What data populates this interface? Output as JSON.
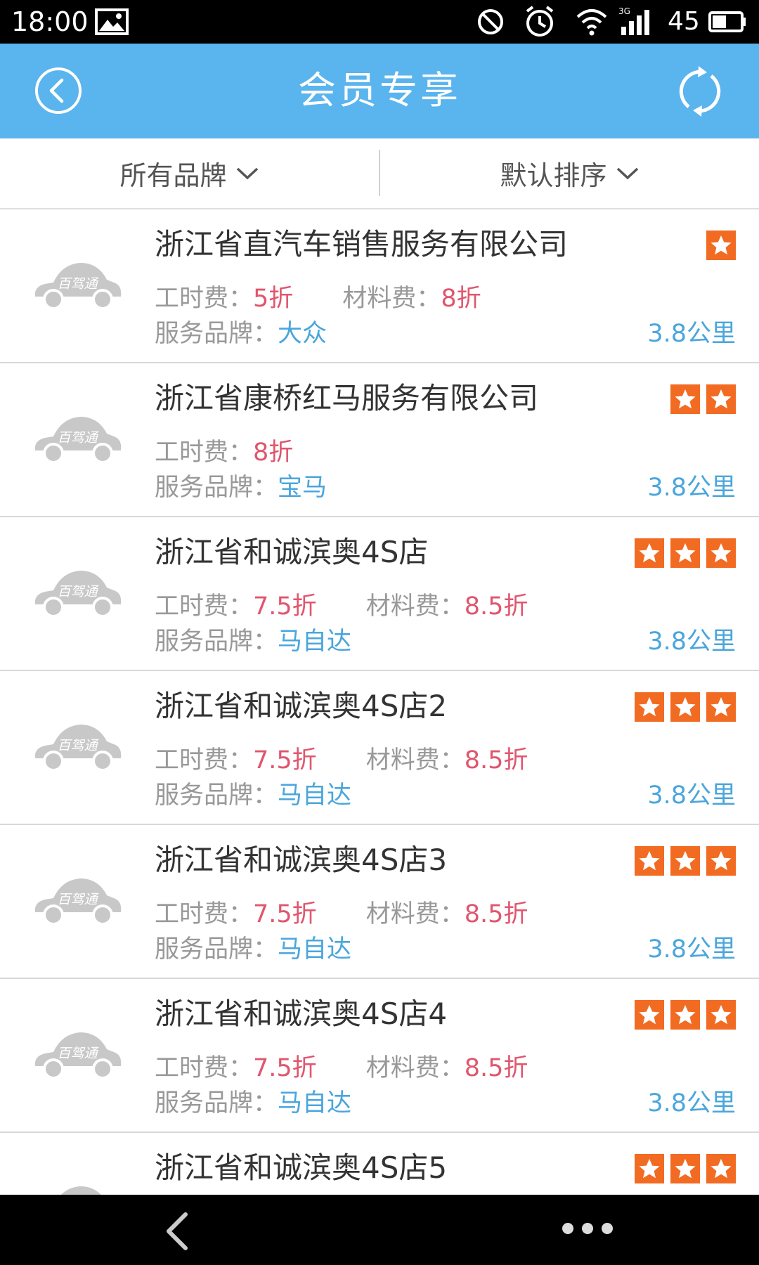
{
  "status_bar": {
    "time": "18:00",
    "battery": "45",
    "network": "3G",
    "icons": [
      "image-icon",
      "do-not-disturb-icon",
      "alarm-icon",
      "wifi-icon",
      "signal-icon",
      "battery-icon"
    ]
  },
  "header": {
    "title": "会员专享",
    "back_icon": "back-circle-icon",
    "refresh_icon": "refresh-icon",
    "background_color": "#5ab4ee"
  },
  "filters": {
    "brand": "所有品牌",
    "sort": "默认排序"
  },
  "colors": {
    "discount": "#e0566e",
    "brand_link": "#4aa6dc",
    "star_badge": "#f26b22"
  },
  "stores": [
    {
      "name": "浙江省直汽车销售服务有限公司",
      "labor_label": "工时费：",
      "labor": "5折",
      "material_label": "材料费：",
      "material": "8折",
      "brand_label": "服务品牌：",
      "brand": "大众",
      "distance": "3.8公里",
      "stars": 1,
      "logo": "百驾通"
    },
    {
      "name": "浙江省康桥红马服务有限公司",
      "labor_label": "工时费：",
      "labor": "8折",
      "material_label": "",
      "material": "",
      "brand_label": "服务品牌：",
      "brand": "宝马",
      "distance": "3.8公里",
      "stars": 2,
      "logo": "百驾通"
    },
    {
      "name": "浙江省和诚滨奥4S店",
      "labor_label": "工时费：",
      "labor": "7.5折",
      "material_label": "材料费：",
      "material": "8.5折",
      "brand_label": "服务品牌：",
      "brand": "马自达",
      "distance": "3.8公里",
      "stars": 3,
      "logo": "百驾通"
    },
    {
      "name": "浙江省和诚滨奥4S店2",
      "labor_label": "工时费：",
      "labor": "7.5折",
      "material_label": "材料费：",
      "material": "8.5折",
      "brand_label": "服务品牌：",
      "brand": "马自达",
      "distance": "3.8公里",
      "stars": 3,
      "logo": "百驾通"
    },
    {
      "name": "浙江省和诚滨奥4S店3",
      "labor_label": "工时费：",
      "labor": "7.5折",
      "material_label": "材料费：",
      "material": "8.5折",
      "brand_label": "服务品牌：",
      "brand": "马自达",
      "distance": "3.8公里",
      "stars": 3,
      "logo": "百驾通"
    },
    {
      "name": "浙江省和诚滨奥4S店4",
      "labor_label": "工时费：",
      "labor": "7.5折",
      "material_label": "材料费：",
      "material": "8.5折",
      "brand_label": "服务品牌：",
      "brand": "马自达",
      "distance": "3.8公里",
      "stars": 3,
      "logo": "百驾通"
    },
    {
      "name": "浙江省和诚滨奥4S店5",
      "labor_label": "",
      "labor": "",
      "material_label": "",
      "material": "",
      "brand_label": "",
      "brand": "",
      "distance": "",
      "stars": 3,
      "logo": "百驾通"
    }
  ],
  "nav_bar": {
    "back_icon": "nav-back-icon",
    "more_icon": "more-dots-icon"
  }
}
